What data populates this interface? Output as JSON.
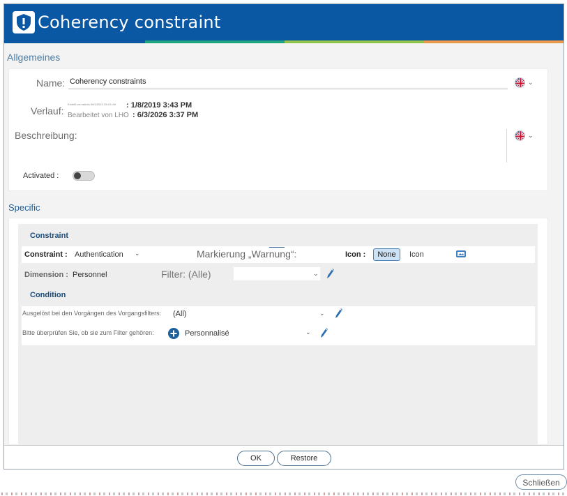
{
  "window": {
    "title": "Coherency constraint",
    "icon": "shield-alert-icon"
  },
  "colors": {
    "titlebar": "#0a57a3",
    "stripes": [
      "#0a57a3",
      "#1aa57f",
      "#8cc34a",
      "#e89a4a"
    ],
    "accent": "#4f7fa5"
  },
  "general": {
    "heading": "Allgemeines",
    "name_label": "Name:",
    "name_value": "Coherency constraints",
    "history_label": "Verlauf:",
    "created_by": "Erstellt von admin 06/1/2019 15:43 Uhr",
    "created_date": ": 1/8/2019 3:43 PM",
    "edited_label": "Bearbeitet von LHO",
    "edited_date": ": 6/3/2026 3:37 PM",
    "description_label": "Beschreibung:",
    "activated_label": "Activated :"
  },
  "specific": {
    "heading": "Specific",
    "constraint_heading": "Constraint",
    "constraint_label": "Constraint :",
    "constraint_value": "Authentication",
    "warning_label": "Markierung „Warnung“:",
    "icon_label": "Icon :",
    "icon_none": "None",
    "icon_option": "Icon",
    "dimension_label": "Dimension :",
    "dimension_value": "Personnel",
    "filter_label": "Filter: (Alle)",
    "condition_heading": "Condition",
    "triggered_label": "Ausgelöst bei den Vorgängen des Vorgangsfilters:",
    "triggered_value": "(All)",
    "check_label": "Bitte überprüfen Sie, ob sie zum Filter gehören:",
    "check_value": "Personnalisé"
  },
  "footer": {
    "ok": "OK",
    "restore": "Restore"
  },
  "close_label": "Schließen"
}
